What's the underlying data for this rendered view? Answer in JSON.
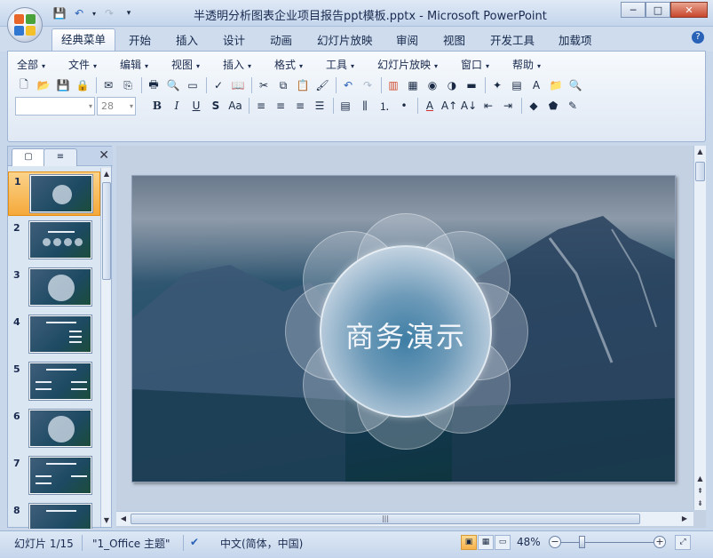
{
  "window": {
    "title": "半透明分析图表企业项目报告ppt模板.pptx - Microsoft PowerPoint",
    "min_label": "─",
    "max_label": "□",
    "close_label": "✕"
  },
  "quick_access": [
    "save-icon",
    "undo-icon",
    "redo-icon",
    "customize-icon"
  ],
  "ribbon_tabs": [
    "经典菜单",
    "开始",
    "插入",
    "设计",
    "动画",
    "幻灯片放映",
    "审阅",
    "视图",
    "开发工具",
    "加载项"
  ],
  "active_tab": "经典菜单",
  "help_label": "?",
  "menus": [
    "全部",
    "文件",
    "编辑",
    "视图",
    "插入",
    "格式",
    "工具",
    "幻灯片放映",
    "窗口",
    "帮助"
  ],
  "format_bar": {
    "font_name": "",
    "font_size": "28"
  },
  "panel": {
    "tab_slides_label": "▢",
    "tab_outline_label": "≡",
    "close_label": "✕",
    "slide_numbers": [
      "1",
      "2",
      "3",
      "4",
      "5",
      "6",
      "7",
      "8"
    ],
    "selected": 1
  },
  "slide": {
    "title": "商务演示"
  },
  "scrollbar": {
    "grip": "|||"
  },
  "status": {
    "slide_info": "幻灯片 1/15",
    "theme": "\"1_Office 主题\"",
    "language": "中文(简体，中国)",
    "zoom": "48%",
    "zoom_fraction": 0.48
  },
  "colors": {
    "accent": "#2a62b8",
    "selected_thumb": "#f5a93a",
    "ribbon_bg": "#dfe8f4"
  }
}
